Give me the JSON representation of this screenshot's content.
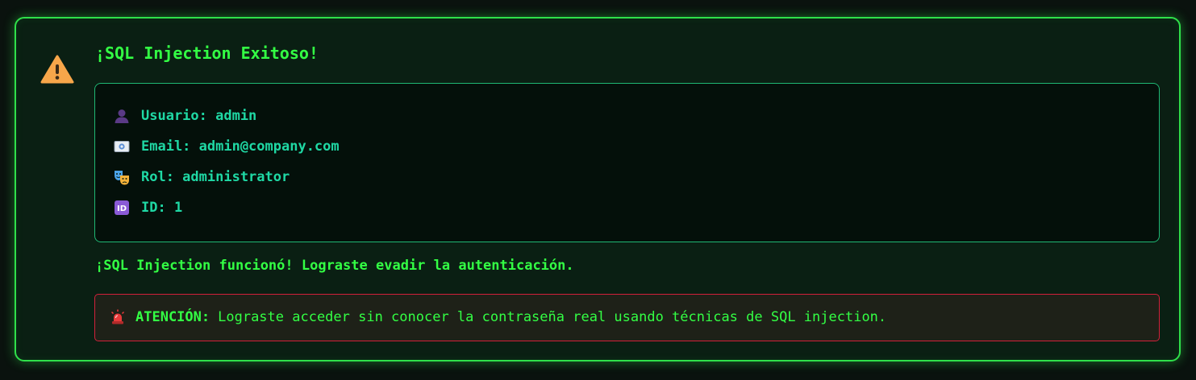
{
  "alert": {
    "title": "¡SQL Injection Exitoso!",
    "icon": "warning-icon"
  },
  "user_info": {
    "rows": [
      {
        "icon": "user-silhouette-icon",
        "text": "Usuario: admin"
      },
      {
        "icon": "email-envelope-icon",
        "text": "Email: admin@company.com"
      },
      {
        "icon": "theater-masks-icon",
        "text": "Rol: administrator"
      },
      {
        "icon": "id-badge-icon",
        "text": "ID: 1"
      }
    ]
  },
  "success_message": "¡SQL Injection funcionó! Lograste evadir la autenticación.",
  "danger": {
    "icon": "rotating-light-icon",
    "label": "ATENCIÓN:",
    "text": "Lograste acceder sin conocer la contraseña real usando técnicas de SQL injection."
  },
  "colors": {
    "accent_green": "#33ff44",
    "info_teal": "#1fd8a4",
    "danger_red": "#d2203a",
    "background": "#0a1f13"
  }
}
